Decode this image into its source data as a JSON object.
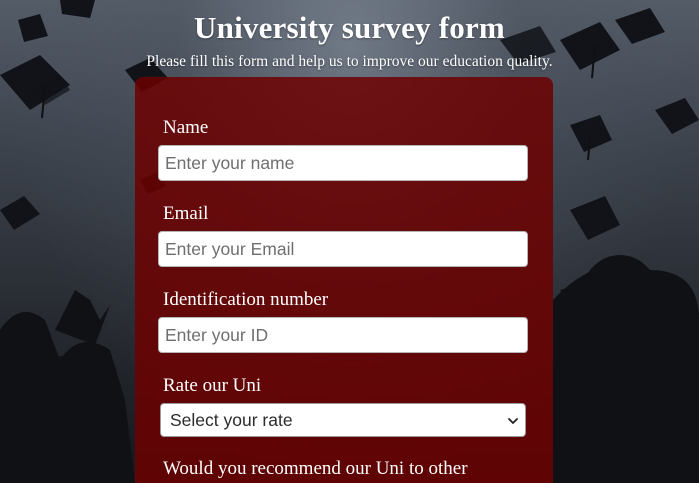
{
  "header": {
    "title": "University survey form",
    "subtitle": "Please fill this form and help us to improve our education quality."
  },
  "form": {
    "name_label": "Name",
    "name_placeholder": "Enter your name",
    "email_label": "Email",
    "email_placeholder": "Enter your Email",
    "id_label": "Identification number",
    "id_placeholder": "Enter your ID",
    "rate_label": "Rate our Uni",
    "rate_selected": "Select your rate",
    "recommend_label": "Would you recommend our Uni to other"
  },
  "colors": {
    "panel": "#6e0000",
    "text": "#ffffff",
    "input_bg": "#ffffff"
  },
  "icons": {
    "select_arrow": "chevron-down-icon"
  }
}
